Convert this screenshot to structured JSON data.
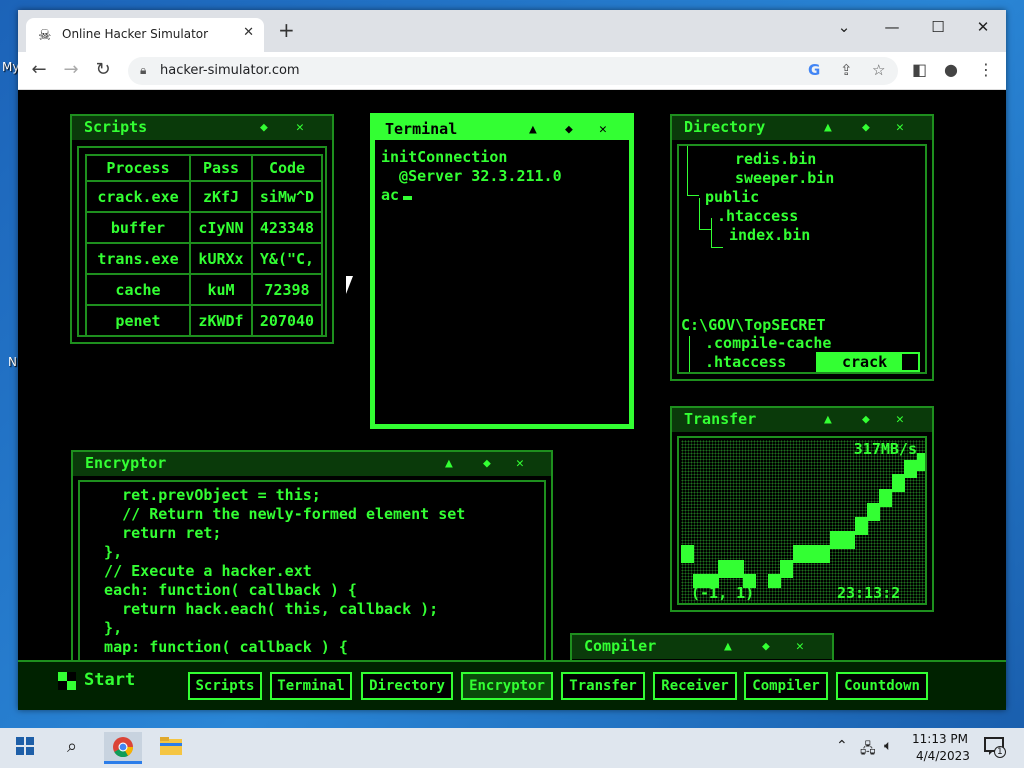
{
  "desktop": {
    "label_1": "My",
    "label_2": "N"
  },
  "browser": {
    "tab_title": "Online Hacker Simulator",
    "tab_icon": "skull-crossbones-icon",
    "tab_close": "✕",
    "new_tab": "+",
    "url": "hacker-simulator.com",
    "window_controls": {
      "minimize": "—",
      "maximize": "☐",
      "close": "✕",
      "tab_search": "⌄"
    }
  },
  "scripts": {
    "title": "Scripts",
    "headers": [
      "Process",
      "Pass",
      "Code"
    ],
    "rows": [
      [
        "crack.exe",
        "zKfJ",
        "siMw^D"
      ],
      [
        "buffer",
        "cIyNN",
        "423348"
      ],
      [
        "trans.exe",
        "kURXx",
        "Y&(\"C,"
      ],
      [
        "cache",
        "kuM",
        "72398"
      ],
      [
        "penet",
        "zKWDf",
        "207040"
      ]
    ]
  },
  "terminal": {
    "title": "Terminal",
    "lines": [
      "initConnection",
      "  @Server 32.3.211.0",
      "ac"
    ]
  },
  "directory": {
    "title": "Directory",
    "lines": [
      "redis.bin",
      "sweeper.bin",
      "public",
      ".htaccess",
      "index.bin"
    ],
    "path": "C:\\GOV\\TopSECRET",
    "sub_lines": [
      ".compile-cache",
      ".htaccess"
    ],
    "action_label": "crack"
  },
  "encryptor": {
    "title": "Encryptor",
    "lines": [
      "    ret.prevObject = this;",
      "    // Return the newly-formed element set",
      "    return ret;",
      "  },",
      "  // Execute a hacker.ext",
      "  each: function( callback ) {",
      "    return hack.each( this, callback );",
      "  },",
      "  map: function( callback ) {"
    ]
  },
  "transfer": {
    "title": "Transfer",
    "rate": "317MB/s",
    "coords": "(-1, 1)",
    "time": "23:13:2",
    "levels": [
      0.3,
      0.1,
      0.1,
      0.2,
      0.2,
      0.1,
      0.0,
      0.1,
      0.2,
      0.3,
      0.3,
      0.3,
      0.4,
      0.4,
      0.5,
      0.6,
      0.7,
      0.8,
      0.9,
      0.95
    ]
  },
  "compiler": {
    "title": "Compiler"
  },
  "sim_taskbar": {
    "start_label": "Start",
    "buttons": [
      "Scripts",
      "Terminal",
      "Directory",
      "Encryptor",
      "Transfer",
      "Receiver",
      "Compiler",
      "Countdown"
    ]
  },
  "panel_controls": {
    "up": "▲",
    "resize": "◆",
    "close": "✕"
  },
  "win_taskbar": {
    "time": "11:13 PM",
    "date": "4/4/2023",
    "notification_count": "1"
  },
  "colors": {
    "accent": "#33ff33",
    "dim": "#1e8f1e"
  }
}
